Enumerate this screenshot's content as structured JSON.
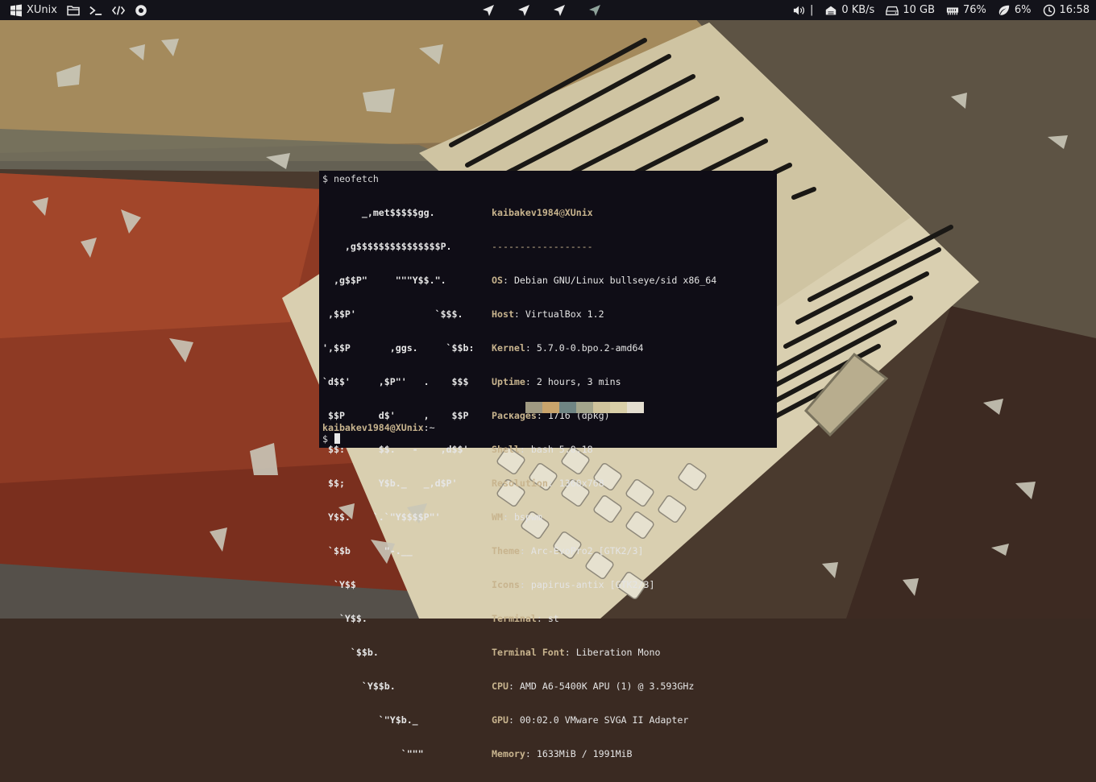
{
  "topbar": {
    "start_label": "XUnix",
    "launchers": [
      "folder-icon",
      "terminal-icon",
      "code-icon",
      "ubuntu-icon"
    ],
    "workspaces": [
      "send-icon",
      "send-icon",
      "send-icon",
      "send-icon"
    ],
    "volume_sep": "|",
    "network": "0 KB/s",
    "disk": "10 GB",
    "memory": "76%",
    "cpu": "6%",
    "clock": "16:58"
  },
  "terminal": {
    "command_prompt": "$",
    "command": "neofetch",
    "ascii_art": [
      "       _,met$$$$$gg.",
      "    ,g$$$$$$$$$$$$$$$P.",
      "  ,g$$P\"     \"\"\"Y$$.\".",
      " ,$$P'              `$$$.",
      "',$$P       ,ggs.     `$$b:",
      "`d$$'     ,$P\"'   .    $$$",
      " $$P      d$'     ,    $$P",
      " $$:      $$.   -    ,d$$'",
      " $$;      Y$b._   _,d$P'",
      " Y$$.    `.`\"Y$$$$P\"'",
      " `$$b      \"-.__",
      "  `Y$$",
      "   `Y$$.",
      "     `$$b.",
      "       `Y$$b.",
      "          `\"Y$b._",
      "              `\"\"\""
    ],
    "user": "kaibakev1984",
    "host": "XUnix",
    "at": "@",
    "separator": "------------------",
    "info": [
      {
        "key": "OS",
        "value": "Debian GNU/Linux bullseye/sid x86_64"
      },
      {
        "key": "Host",
        "value": "VirtualBox 1.2"
      },
      {
        "key": "Kernel",
        "value": "5.7.0-0.bpo.2-amd64"
      },
      {
        "key": "Uptime",
        "value": "2 hours, 3 mins"
      },
      {
        "key": "Packages",
        "value": "1716 (dpkg)"
      },
      {
        "key": "Shell",
        "value": "bash 5.0.18"
      },
      {
        "key": "Resolution",
        "value": "1360x768"
      },
      {
        "key": "WM",
        "value": "bspwm"
      },
      {
        "key": "Theme",
        "value": "Arc-EvoPro2 [GTK2/3]"
      },
      {
        "key": "Icons",
        "value": "papirus-antix [GTK2/3]"
      },
      {
        "key": "Terminal",
        "value": "st"
      },
      {
        "key": "Terminal Font",
        "value": "Liberation Mono"
      },
      {
        "key": "CPU",
        "value": "AMD A6-5400K APU (1) @ 3.593GHz"
      },
      {
        "key": "GPU",
        "value": "00:02.0 VMware SVGA II Adapter"
      },
      {
        "key": "Memory",
        "value": "1633MiB / 1991MiB"
      }
    ],
    "palette": [
      "#0f0d16",
      "#a09a82",
      "#c9a46c",
      "#6f8584",
      "#a3a58c",
      "#cfc39c",
      "#d9cfa8",
      "#e4ded0"
    ],
    "prompt_user_host": "kaibakev1984@XUnix",
    "prompt_path": ":~",
    "prompt_symbol": "$"
  }
}
